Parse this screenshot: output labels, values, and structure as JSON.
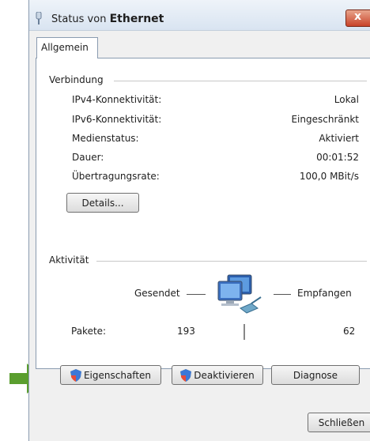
{
  "window": {
    "title_prefix": "Status von",
    "title_name": "Ethernet",
    "close_label": "x"
  },
  "tabs": [
    {
      "label": "Allgemein"
    }
  ],
  "connection": {
    "group_label": "Verbindung",
    "rows": [
      {
        "label": "IPv4-Konnektivität:",
        "value": "Lokal"
      },
      {
        "label": "IPv6-Konnektivität:",
        "value": "Eingeschränkt"
      },
      {
        "label": "Medienstatus:",
        "value": "Aktiviert"
      },
      {
        "label": "Dauer:",
        "value": "00:01:52"
      },
      {
        "label": "Übertragungsrate:",
        "value": "100,0 MBit/s"
      }
    ],
    "details_button": "Details..."
  },
  "activity": {
    "group_label": "Aktivität",
    "sent_label": "Gesendet",
    "received_label": "Empfangen",
    "packets_label": "Pakete:",
    "packets_sent": "193",
    "packets_received": "62"
  },
  "buttons": {
    "properties": "Eigenschaften",
    "disable": "Deaktivieren",
    "diagnose": "Diagnose",
    "close": "Schließen"
  },
  "colors": {
    "annotation_arrow": "#5a9e2e",
    "close_button": "#c8432a"
  }
}
